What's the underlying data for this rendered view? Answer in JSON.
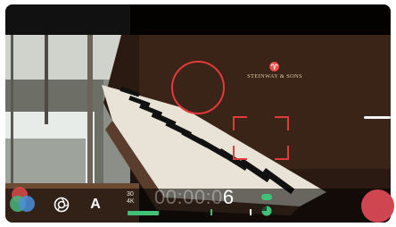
{
  "viewfinder": {
    "brand_line1": "STEINWAY",
    "brand_amp": "&",
    "brand_line2": "SONS"
  },
  "hud": {
    "frame_rate": "30",
    "resolution": "4K",
    "timecode_dim": "00:00:0",
    "timecode_lit": "6",
    "auto_label": "A"
  },
  "colors": {
    "accent_red": "#e23a3c",
    "record_red": "#cf4650",
    "meter_green": "#3fc277"
  },
  "icons": [
    "color-balls-icon",
    "aperture-icon",
    "auto-icon",
    "record-icon",
    "battery-pie-icon",
    "storage-pill-icon"
  ]
}
